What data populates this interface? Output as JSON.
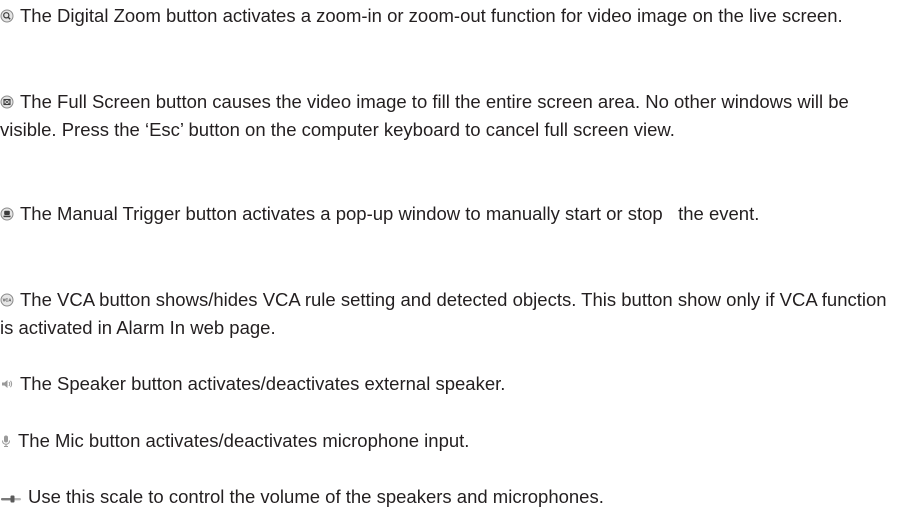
{
  "items": [
    {
      "icon": "digital-zoom-icon",
      "text": "The Digital Zoom button activates a zoom-in or zoom-out function for video image on the live screen."
    },
    {
      "icon": "full-screen-icon",
      "text": "The Full Screen button causes the video image to fill the entire screen area. No other windows will be visible. Press the ‘Esc’ button on the computer keyboard to cancel full screen view."
    },
    {
      "icon": "manual-trigger-icon",
      "text": "The Manual Trigger button activates a pop-up window to manually start or stop   the event."
    },
    {
      "icon": "vca-icon",
      "icon_label": "VCA",
      "text": "The VCA button shows/hides VCA rule setting and detected objects. This button show only if VCA function is activated in Alarm In web page."
    },
    {
      "icon": "speaker-icon",
      "text": "The Speaker button activates/deactivates external speaker."
    },
    {
      "icon": "mic-icon",
      "text": "The Mic button activates/deactivates microphone input."
    },
    {
      "icon": "volume-slider-icon",
      "text": "Use this scale to control the volume of the speakers and microphones."
    }
  ]
}
